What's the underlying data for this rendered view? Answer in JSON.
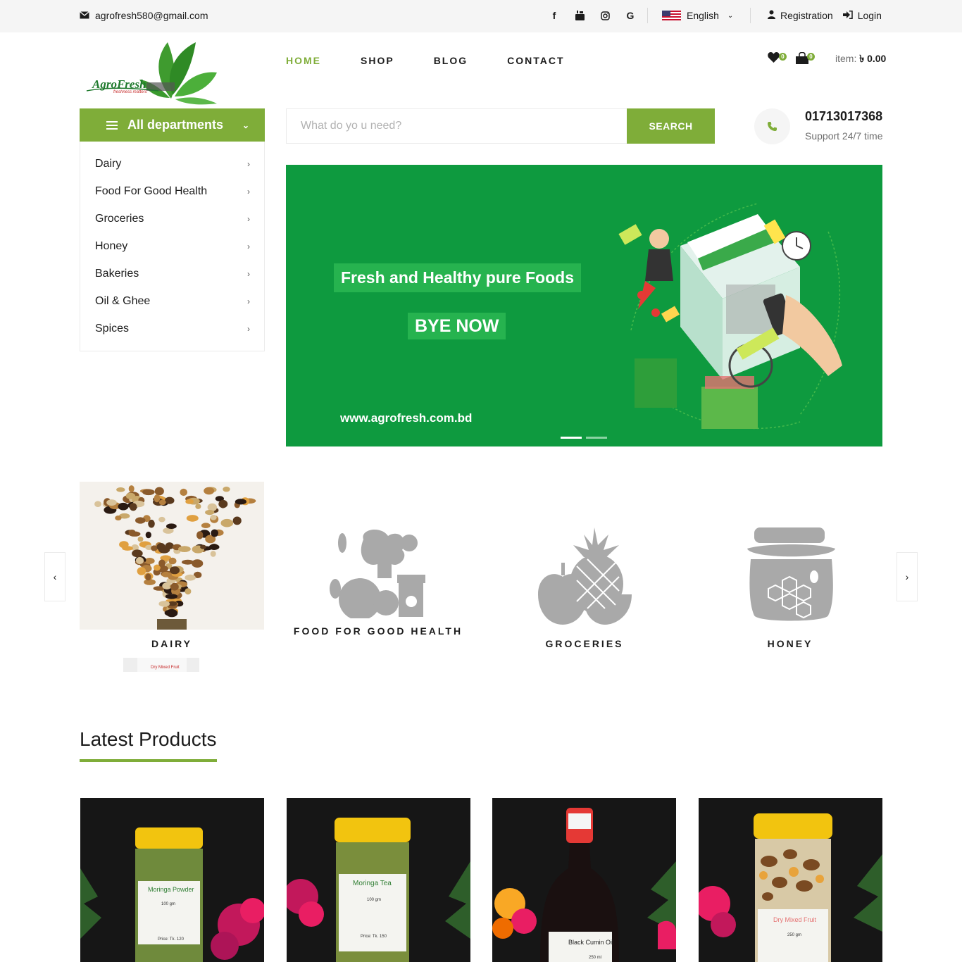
{
  "topbar": {
    "email": "agrofresh580@gmail.com",
    "social_icons": [
      "facebook-icon",
      "youtube-icon",
      "instagram-icon",
      "google-icon"
    ],
    "language": "English",
    "registration": "Registration",
    "login": "Login"
  },
  "logo": {
    "text": "AgroFresh",
    "tagline": "freshness matters"
  },
  "nav": {
    "items": [
      {
        "label": "HOME",
        "active": true
      },
      {
        "label": "SHOP",
        "active": false
      },
      {
        "label": "BLOG",
        "active": false
      },
      {
        "label": "CONTACT",
        "active": false
      }
    ]
  },
  "cart": {
    "wishlist_count": "0",
    "cart_count": "0",
    "item_label": "item:",
    "total": "৳ 0.00"
  },
  "departments": {
    "title": "All departments",
    "items": [
      "Dairy",
      "Food For Good Health",
      "Groceries",
      "Honey",
      "Bakeries",
      "Oil & Ghee",
      "Spices"
    ]
  },
  "search": {
    "placeholder": "What do yo u need?",
    "button": "SEARCH"
  },
  "support": {
    "phone": "01713017368",
    "text": "Support 24/7 time"
  },
  "hero": {
    "headline": "Fresh and Healthy pure Foods",
    "cta": "BYE NOW",
    "url": "www.agrofresh.com.bd",
    "slide_count": 2,
    "active_slide": 1
  },
  "categories": {
    "items": [
      "DAIRY",
      "FOOD FOR GOOD HEALTH",
      "GROCERIES",
      "HONEY"
    ],
    "dairy_peek_label": "Dry Mixed Fruit"
  },
  "latest_products": {
    "title": "Latest Products",
    "items": [
      {
        "label": "Moringa Powder",
        "weight": "100 gm",
        "price": "Price: Tk. 120"
      },
      {
        "label": "Moringa Tea",
        "weight": "100 gm",
        "price": "Price: Tk. 150"
      },
      {
        "label": "Black Cumin Oil",
        "weight": "250 ml"
      },
      {
        "label": "Dry Mixed Fruit",
        "weight": "250 gm"
      }
    ]
  },
  "colors": {
    "accent": "#7fad39",
    "hero_bg": "#0e9a3f",
    "text": "#1c1c1c",
    "muted": "#6f6f6f"
  }
}
